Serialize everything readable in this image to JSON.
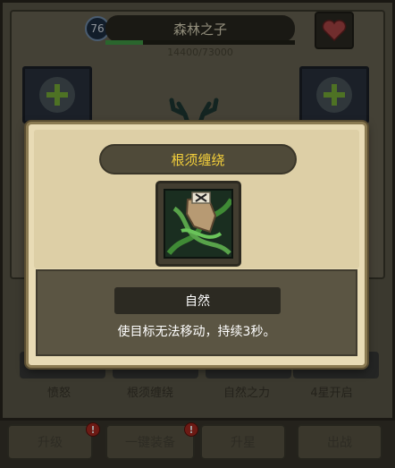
{
  "hero": {
    "level": "76",
    "name": "森林之子",
    "xp_text": "14400/73000",
    "xp_fraction": 0.197
  },
  "skills": [
    {
      "label": "愤怒"
    },
    {
      "label": "根须缠绕"
    },
    {
      "label": "自然之力"
    },
    {
      "label": "4星开启"
    }
  ],
  "buttons": {
    "upgrade": "升级",
    "equip_all": "一键装备",
    "star_up": "升星",
    "battle": "出战",
    "badge": "!"
  },
  "popup": {
    "title": "根须缠绕",
    "element": "自然",
    "description": "使目标无法移动，持续3秒。"
  },
  "colors": {
    "title_text": "#f3cf3b",
    "xp_fill": "#45a449",
    "badge_red": "#b02a21"
  },
  "icons": {
    "heart": "heart-icon",
    "add_slot": "plus-icon",
    "skill": "roots-entangle-icon"
  }
}
